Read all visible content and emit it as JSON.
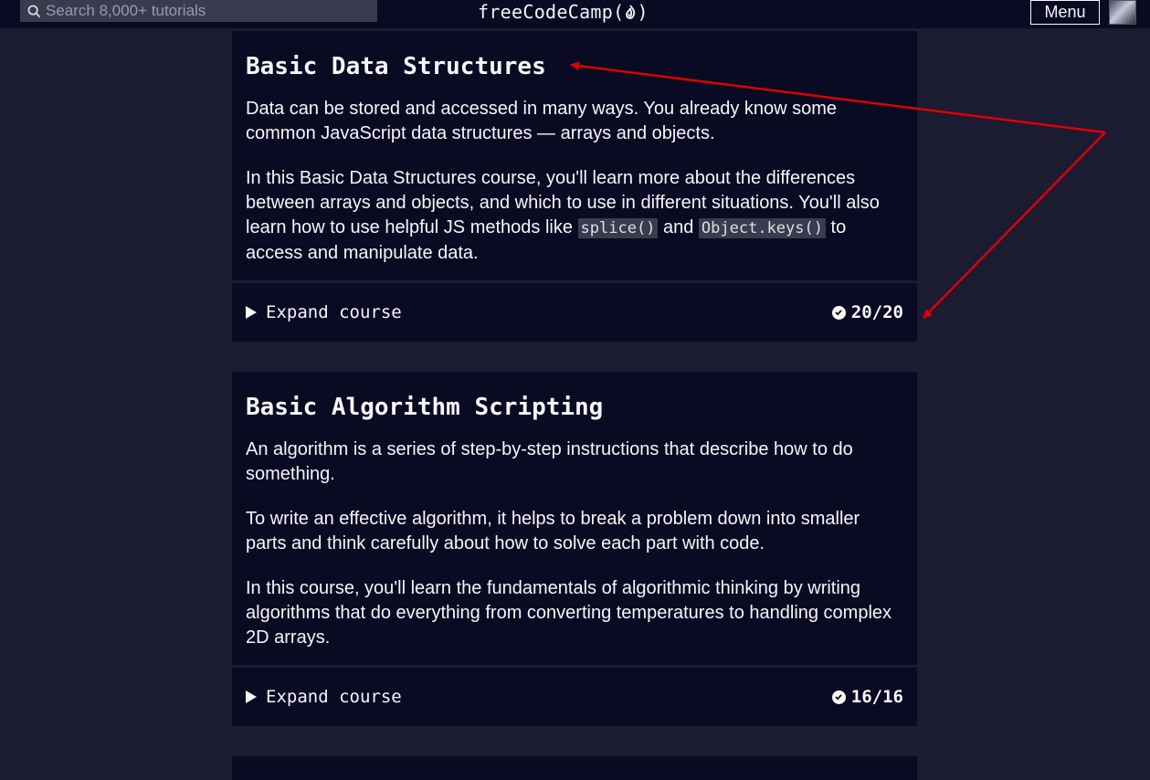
{
  "navbar": {
    "search_placeholder": "Search 8,000+ tutorials",
    "logo_text": "freeCodeCamp(",
    "logo_close": ")",
    "menu_label": "Menu"
  },
  "courses": [
    {
      "title": "Basic Data Structures",
      "p1": "Data can be stored and accessed in many ways. You already know some common JavaScript data structures — arrays and objects.",
      "p2_before": "In this Basic Data Structures course, you'll learn more about the differences between arrays and objects, and which to use in different situations. You'll also learn how to use helpful JS methods like ",
      "code1": "splice()",
      "p2_mid": " and ",
      "code2": "Object.keys()",
      "p2_after": " to access and manipulate data.",
      "expand_label": "Expand course",
      "progress": "20/20"
    },
    {
      "title": "Basic Algorithm Scripting",
      "p1": "An algorithm is a series of step-by-step instructions that describe how to do something.",
      "p2": "To write an effective algorithm, it helps to break a problem down into smaller parts and think carefully about how to solve each part with code.",
      "p3": "In this course, you'll learn the fundamentals of algorithmic thinking by writing algorithms that do everything from converting temperatures to handling complex 2D arrays.",
      "expand_label": "Expand course",
      "progress": "16/16"
    }
  ],
  "colors": {
    "page_bg": "#1b1b32",
    "card_bg": "#0a0a23",
    "annotation": "#e00000"
  }
}
